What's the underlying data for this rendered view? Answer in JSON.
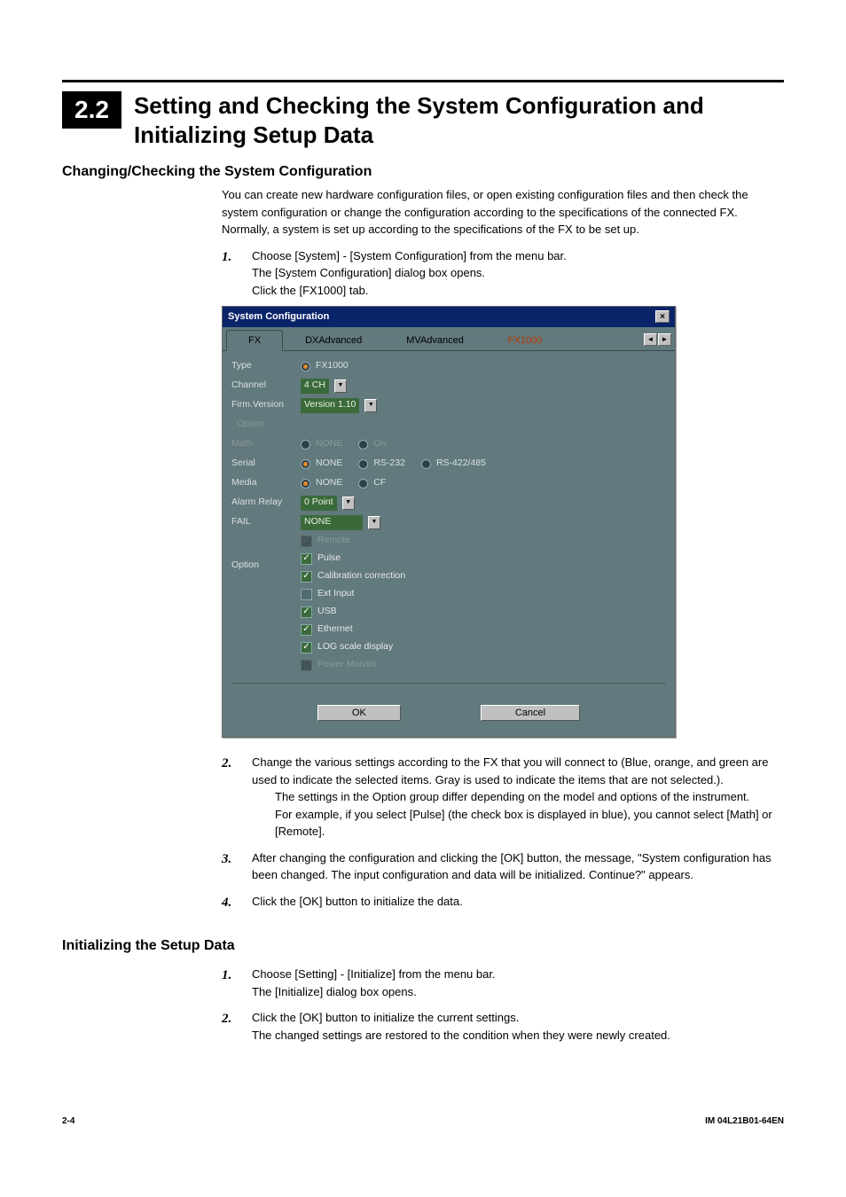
{
  "title": {
    "number": "2.2",
    "text": "Setting and Checking the System Configuration and Initializing Setup Data"
  },
  "section1": {
    "heading": "Changing/Checking the System Configuration",
    "para": "You can create new hardware configuration files, or open existing configuration files and then check the system configuration or change the configuration according to the specifications of the connected FX.",
    "para2": "Normally, a system is set up according to the specifications of the FX to be set up.",
    "step1_num": "1.",
    "step1_a": "Choose [System] - [System Configuration] from the menu bar.",
    "step1_b": "The [System Configuration] dialog box opens.",
    "step1_c": "Click the [FX1000] tab.",
    "step2_num": "2.",
    "step2_a": "Change the various settings according to the FX that you will connect to (Blue, orange, and green are used to indicate the selected items. Gray is used to indicate the items that are not selected.).",
    "step2_b": "The settings in the Option group differ depending on the model and options of the instrument.",
    "step2_c": "For example, if you select [Pulse] (the check box is displayed in blue), you cannot select [Math] or [Remote].",
    "step3_num": "3.",
    "step3_a": "After changing the configuration and clicking the [OK] button, the message, \"System configuration has been changed. The input configuration and data will be initialized. Continue?\" appears.",
    "step4_num": "4.",
    "step4_a": "Click the [OK] button to initialize the data."
  },
  "section2": {
    "heading": "Initializing the Setup Data",
    "step1_num": "1.",
    "step1_a": "Choose [Setting] - [Initialize] from the menu bar.",
    "step1_b": "The [Initialize] dialog box opens.",
    "step2_num": "2.",
    "step2_a": "Click the [OK] button to initialize the current settings.",
    "step2_b": "The changed settings are restored to the condition when they were newly created."
  },
  "dialog": {
    "title": "System Configuration",
    "tabs": {
      "t0": "FX",
      "t1": "DXAdvanced",
      "t2": "MVAdvanced",
      "t3": "FX1000"
    },
    "labels": {
      "type": "Type",
      "channel": "Channel",
      "firm": "Firm.Version",
      "option_hdr": "Option",
      "math": "Math",
      "serial": "Serial",
      "media": "Media",
      "alarm": "Alarm Relay",
      "fail": "FAIL",
      "option": "Option"
    },
    "values": {
      "type": "FX1000",
      "channel": "4 CH",
      "firm": "Version 1.10",
      "math_none": "NONE",
      "math_on": "On",
      "serial_none": "NONE",
      "serial_232": "RS-232",
      "serial_485": "RS-422/485",
      "media_none": "NONE",
      "media_cf": "CF",
      "alarm": "0 Point",
      "fail": "NONE",
      "remote": "Remote",
      "pulse": "Pulse",
      "calib": "Calibration correction",
      "ext": "Ext Input",
      "usb": "USB",
      "eth": "Ethernet",
      "log": "LOG scale display",
      "power": "Power Monitor"
    },
    "buttons": {
      "ok": "OK",
      "cancel": "Cancel"
    }
  },
  "footer": {
    "left": "2-4",
    "right": "IM 04L21B01-64EN"
  }
}
